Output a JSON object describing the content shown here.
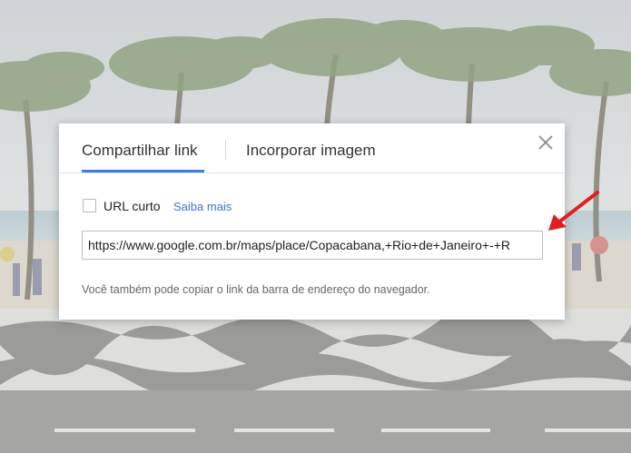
{
  "dialog": {
    "tabs": [
      {
        "label": "Compartilhar link",
        "active": true
      },
      {
        "label": "Incorporar imagem",
        "active": false
      }
    ],
    "close_icon": "close-icon",
    "short_url": {
      "label": "URL curto",
      "checked": false,
      "learn_more": "Saiba mais"
    },
    "link_value": "https://www.google.com.br/maps/place/Copacabana,+Rio+de+Janeiro+-+R",
    "hint": "Você também pode copiar o link da barra de endereço do navegador."
  },
  "colors": {
    "accent": "#3e7de0",
    "link": "#3a74d6",
    "arrow": "#e02020",
    "overlay": "#ffffff"
  },
  "annotation": {
    "arrow_icon": "red-arrow-icon"
  }
}
